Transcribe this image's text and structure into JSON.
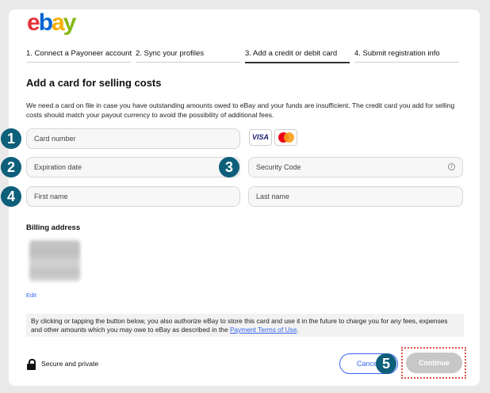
{
  "brand": {
    "logo_letters": [
      "e",
      "b",
      "a",
      "y"
    ],
    "logo_colors": [
      "#e53238",
      "#0064d2",
      "#f5af02",
      "#86b817"
    ]
  },
  "steps": [
    {
      "label": "1. Connect a Payoneer account",
      "active": false
    },
    {
      "label": "2. Sync your profiles",
      "active": false
    },
    {
      "label": "3. Add a credit or debit card",
      "active": true
    },
    {
      "label": "4. Submit registration info",
      "active": false
    }
  ],
  "page_title": "Add a card for selling costs",
  "description": "We need a card on file in case you have outstanding amounts owed to eBay and your funds are insufficient. The credit card you add for selling costs should match your payout currency to avoid the possibility of additional fees.",
  "fields": {
    "card_number": "Card number",
    "expiration_date": "Expiration date",
    "security_code": "Security Code",
    "first_name": "First name",
    "last_name": "Last name"
  },
  "card_logos": {
    "visa": "VISA",
    "mastercard_icon": "mastercard-icon"
  },
  "badges": [
    "1",
    "2",
    "3",
    "4",
    "5"
  ],
  "billing": {
    "title": "Billing address",
    "edit_label": "Edit"
  },
  "consent": {
    "text": "By clicking or tapping the button below, you also authorize eBay to store this card and use it in the future to charge you for any fees, expenses and other amounts which you may owe to eBay as described in the ",
    "link": "Payment Terms of Use",
    "end": "."
  },
  "footer": {
    "secure_label": "Secure and private",
    "cancel_label": "Cancel",
    "continue_label": "Continue"
  },
  "colors": {
    "accent": "#3665f3",
    "badge": "#0e5f7a",
    "highlight": "#e0504c"
  }
}
